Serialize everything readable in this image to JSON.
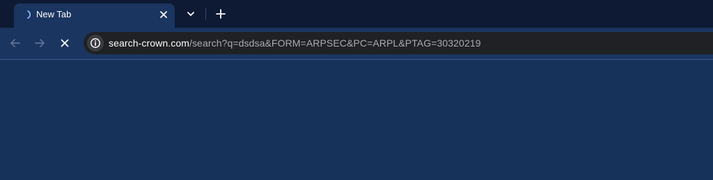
{
  "tabs": [
    {
      "title": "New Tab",
      "loading": true
    }
  ],
  "toolbar": {
    "url_host": "search-crown.com",
    "url_rest": "/search?q=dsdsa&FORM=ARPSEC&PC=ARPL&PTAG=30320219"
  },
  "colors": {
    "tabstrip": "#0e1a33",
    "toolbar": "#1a3560",
    "omnibox": "#202124",
    "content": "#17325a"
  },
  "icons": [
    "spinner-icon",
    "close-icon",
    "chevron-down-icon",
    "plus-icon",
    "arrow-left-icon",
    "arrow-right-icon",
    "stop-icon",
    "info-icon"
  ]
}
